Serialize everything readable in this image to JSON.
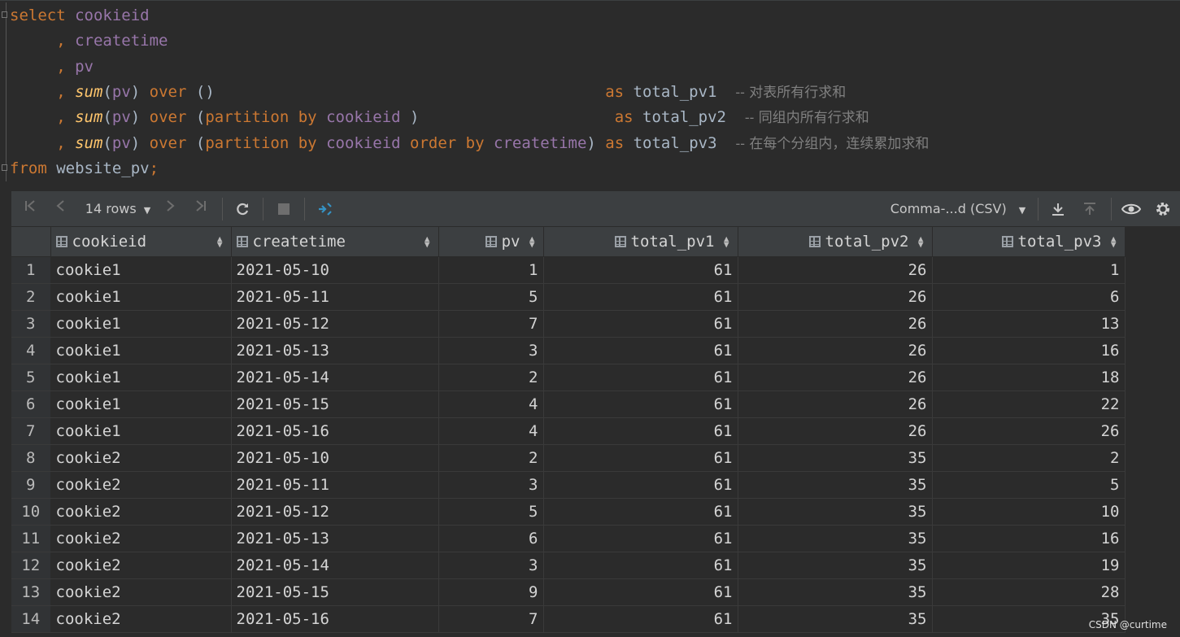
{
  "editor": {
    "lines": [
      {
        "parts": [
          {
            "c": "kw",
            "t": "select"
          },
          {
            "c": "plain",
            "t": " "
          },
          {
            "c": "col",
            "t": "cookieid"
          }
        ]
      },
      {
        "parts": [
          {
            "c": "plain",
            "t": "     "
          },
          {
            "c": "kw",
            "t": ","
          },
          {
            "c": "plain",
            "t": " "
          },
          {
            "c": "col",
            "t": "createtime"
          }
        ]
      },
      {
        "parts": [
          {
            "c": "plain",
            "t": "     "
          },
          {
            "c": "kw",
            "t": ","
          },
          {
            "c": "plain",
            "t": " "
          },
          {
            "c": "col",
            "t": "pv"
          }
        ]
      },
      {
        "parts": [
          {
            "c": "plain",
            "t": "     "
          },
          {
            "c": "kw",
            "t": ","
          },
          {
            "c": "plain",
            "t": " "
          },
          {
            "c": "fn",
            "t": "sum"
          },
          {
            "c": "plain",
            "t": "("
          },
          {
            "c": "col",
            "t": "pv"
          },
          {
            "c": "plain",
            "t": ") "
          },
          {
            "c": "kw",
            "t": "over"
          },
          {
            "c": "plain",
            "t": " ()                                          "
          },
          {
            "c": "kw",
            "t": "as"
          },
          {
            "c": "plain",
            "t": " total_pv1  "
          },
          {
            "c": "cmt",
            "t": "-- 对表所有行求和"
          }
        ]
      },
      {
        "parts": [
          {
            "c": "plain",
            "t": "     "
          },
          {
            "c": "kw",
            "t": ","
          },
          {
            "c": "plain",
            "t": " "
          },
          {
            "c": "fn",
            "t": "sum"
          },
          {
            "c": "plain",
            "t": "("
          },
          {
            "c": "col",
            "t": "pv"
          },
          {
            "c": "plain",
            "t": ") "
          },
          {
            "c": "kw",
            "t": "over"
          },
          {
            "c": "plain",
            "t": " ("
          },
          {
            "c": "kw",
            "t": "partition by"
          },
          {
            "c": "plain",
            "t": " "
          },
          {
            "c": "col",
            "t": "cookieid"
          },
          {
            "c": "plain",
            "t": " )                     "
          },
          {
            "c": "kw",
            "t": "as"
          },
          {
            "c": "plain",
            "t": " total_pv2  "
          },
          {
            "c": "cmt",
            "t": "-- 同组内所有行求和"
          }
        ]
      },
      {
        "parts": [
          {
            "c": "plain",
            "t": "     "
          },
          {
            "c": "kw",
            "t": ","
          },
          {
            "c": "plain",
            "t": " "
          },
          {
            "c": "fn",
            "t": "sum"
          },
          {
            "c": "plain",
            "t": "("
          },
          {
            "c": "col",
            "t": "pv"
          },
          {
            "c": "plain",
            "t": ") "
          },
          {
            "c": "kw",
            "t": "over"
          },
          {
            "c": "plain",
            "t": " ("
          },
          {
            "c": "kw",
            "t": "partition by"
          },
          {
            "c": "plain",
            "t": " "
          },
          {
            "c": "col",
            "t": "cookieid"
          },
          {
            "c": "plain",
            "t": " "
          },
          {
            "c": "kw",
            "t": "order by"
          },
          {
            "c": "plain",
            "t": " "
          },
          {
            "c": "col",
            "t": "createtime"
          },
          {
            "c": "plain",
            "t": ") "
          },
          {
            "c": "kw",
            "t": "as"
          },
          {
            "c": "plain",
            "t": " total_pv3  "
          },
          {
            "c": "cmt",
            "t": "-- 在每个分组内，连续累加求和"
          }
        ]
      },
      {
        "parts": [
          {
            "c": "kw",
            "t": "from"
          },
          {
            "c": "plain",
            "t": " website_pv"
          },
          {
            "c": "kw",
            "t": ";"
          }
        ]
      }
    ]
  },
  "toolbar": {
    "rows_label": "14 rows",
    "format_label": "Comma-...d (CSV)",
    "icons": [
      "first-page-icon",
      "prev-page-icon",
      "next-page-icon",
      "last-page-icon",
      "refresh-icon",
      "stop-icon",
      "pin-tab-icon",
      "download-icon",
      "upload-icon",
      "view-icon",
      "settings-icon"
    ]
  },
  "grid": {
    "columns": [
      {
        "name": "cookieid",
        "align": "left"
      },
      {
        "name": "createtime",
        "align": "left"
      },
      {
        "name": "pv",
        "align": "right"
      },
      {
        "name": "total_pv1",
        "align": "right"
      },
      {
        "name": "total_pv2",
        "align": "right"
      },
      {
        "name": "total_pv3",
        "align": "right"
      }
    ],
    "rows": [
      [
        "1",
        "cookie1",
        "2021-05-10",
        "1",
        "61",
        "26",
        "1"
      ],
      [
        "2",
        "cookie1",
        "2021-05-11",
        "5",
        "61",
        "26",
        "6"
      ],
      [
        "3",
        "cookie1",
        "2021-05-12",
        "7",
        "61",
        "26",
        "13"
      ],
      [
        "4",
        "cookie1",
        "2021-05-13",
        "3",
        "61",
        "26",
        "16"
      ],
      [
        "5",
        "cookie1",
        "2021-05-14",
        "2",
        "61",
        "26",
        "18"
      ],
      [
        "6",
        "cookie1",
        "2021-05-15",
        "4",
        "61",
        "26",
        "22"
      ],
      [
        "7",
        "cookie1",
        "2021-05-16",
        "4",
        "61",
        "26",
        "26"
      ],
      [
        "8",
        "cookie2",
        "2021-05-10",
        "2",
        "61",
        "35",
        "2"
      ],
      [
        "9",
        "cookie2",
        "2021-05-11",
        "3",
        "61",
        "35",
        "5"
      ],
      [
        "10",
        "cookie2",
        "2021-05-12",
        "5",
        "61",
        "35",
        "10"
      ],
      [
        "11",
        "cookie2",
        "2021-05-13",
        "6",
        "61",
        "35",
        "16"
      ],
      [
        "12",
        "cookie2",
        "2021-05-14",
        "3",
        "61",
        "35",
        "19"
      ],
      [
        "13",
        "cookie2",
        "2021-05-15",
        "9",
        "61",
        "35",
        "28"
      ],
      [
        "14",
        "cookie2",
        "2021-05-16",
        "7",
        "61",
        "35",
        "35"
      ]
    ]
  },
  "watermark": "CSDN @curtime"
}
